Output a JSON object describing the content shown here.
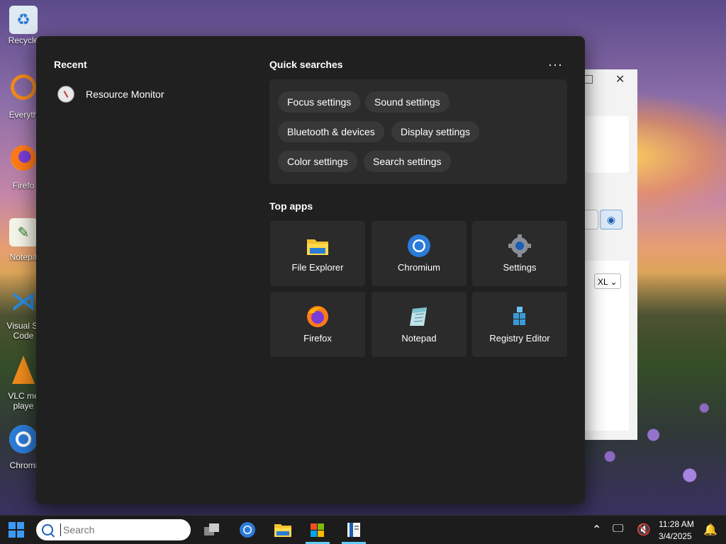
{
  "desktop": {
    "icons": [
      {
        "name": "recycle-bin",
        "label": "Recycle"
      },
      {
        "name": "everything",
        "label": "Everyth"
      },
      {
        "name": "firefox",
        "label": "Firefo"
      },
      {
        "name": "notepad",
        "label": "Notepa"
      },
      {
        "name": "vscode",
        "label": "Visual St\nCode"
      },
      {
        "name": "vlc",
        "label": "VLC me\nplaye"
      },
      {
        "name": "chromium",
        "label": "Chromi"
      }
    ]
  },
  "background_window": {
    "select_value": "XL",
    "close_glyph": "✕"
  },
  "start_menu": {
    "recent_title": "Recent",
    "recent_items": [
      {
        "label": "Resource Monitor"
      }
    ],
    "quick_searches_title": "Quick searches",
    "more_glyph": "···",
    "quick_searches": [
      {
        "label": "Focus settings"
      },
      {
        "label": "Sound settings"
      },
      {
        "label": "Bluetooth & devices"
      },
      {
        "label": "Display settings"
      },
      {
        "label": "Color settings"
      },
      {
        "label": "Search settings"
      }
    ],
    "top_apps_title": "Top apps",
    "top_apps": [
      {
        "label": "File Explorer",
        "icon": "folder-icon"
      },
      {
        "label": "Chromium",
        "icon": "chromium-icon"
      },
      {
        "label": "Settings",
        "icon": "gear-icon"
      },
      {
        "label": "Firefox",
        "icon": "firefox-icon"
      },
      {
        "label": "Notepad",
        "icon": "notepad-icon"
      },
      {
        "label": "Registry Editor",
        "icon": "registry-icon"
      }
    ]
  },
  "taskbar": {
    "search_placeholder": "Search",
    "time": "11:28 AM",
    "date": "3/4/2025"
  },
  "colors": {
    "accent": "#3b9af5",
    "menu_bg": "#202020",
    "tile_bg": "#2b2b2b"
  }
}
